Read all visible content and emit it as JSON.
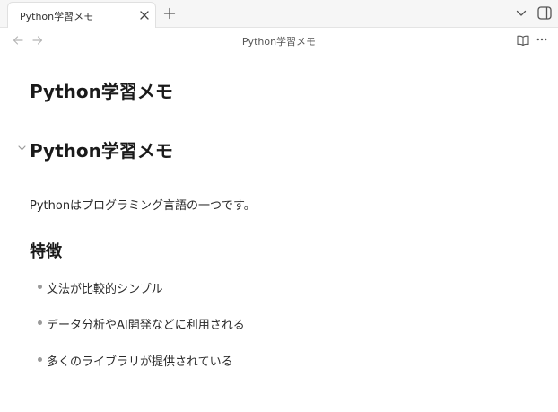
{
  "tabbar": {
    "active_tab_title": "Python学習メモ",
    "close_icon": "close-icon",
    "new_tab_icon": "plus-icon",
    "tab_list_icon": "chevron-down-icon",
    "sidebar_toggle_icon": "sidebar-toggle-icon"
  },
  "navbar": {
    "view_title": "Python学習メモ",
    "back_icon": "arrow-left-icon",
    "forward_icon": "arrow-right-icon",
    "reading_view_icon": "book-icon",
    "more_options_icon": "more-horizontal-icon"
  },
  "note": {
    "inline_title": "Python学習メモ",
    "h1": "Python学習メモ",
    "paragraph": "Pythonはプログラミング言語の一つです。",
    "h2": "特徴",
    "bullets": [
      "文法が比較的シンプル",
      "データ分析やAI開発などに利用される",
      "多くのライブラリが提供されている"
    ]
  },
  "colors": {
    "tabbar_bg": "#f6f6f6",
    "tab_bg": "#ffffff",
    "text": "#222222",
    "muted": "#888888"
  }
}
